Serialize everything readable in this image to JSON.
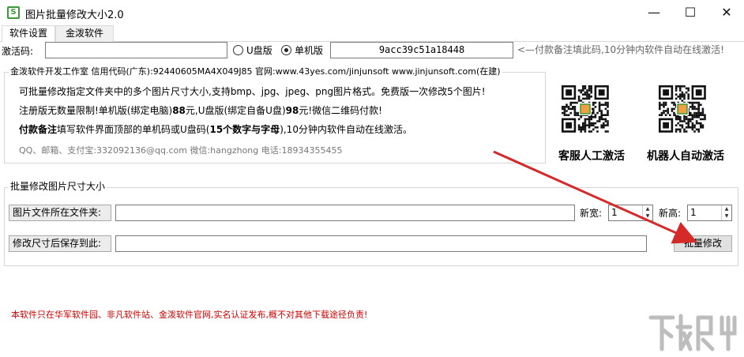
{
  "window": {
    "title": "图片批量修改大小2.0",
    "icon_letter": "S",
    "minimize": "—",
    "maximize": "☐",
    "close": "✕"
  },
  "tabs": [
    {
      "label": "软件设置",
      "active": true
    },
    {
      "label": "金泼软件",
      "active": false
    }
  ],
  "activation": {
    "label": "激活码:",
    "value": "",
    "radio_u": "U盘版",
    "radio_single": "单机版",
    "selected": "单机版",
    "machine_code": "9acc39c51a18448",
    "hint": "<—付款备注填此码,10分钟内软件自动在线激活!"
  },
  "info": {
    "legend": "金泼软件开发工作室 信用代码(广东):92440605MA4X049J85 官网:www.43yes.com/jinjunsoft  www.jinjunsoft.com(在建)",
    "line1": "可批量修改指定文件夹中的多个图片尺寸大小,支持bmp、jpg、jpeg、png图片格式。免费版一次修改5个图片!",
    "line2_a": "注册版无数量限制!单机版(绑定电脑)",
    "line2_b": "88",
    "line2_c": "元,U盘版(绑定自备U盘)",
    "line2_d": "98",
    "line2_e": "元!微信二维码付款!",
    "line3_a": "付款备注",
    "line3_b": "填写软件界面顶部的单机码或U盘码(",
    "line3_c": "15个数字与字母",
    "line3_d": "),10分钟内软件自动在线激活。",
    "contact": "QQ、邮箱、支付宝:332092136@qq.com   微信:hangzhong   电话:18934355455"
  },
  "qr": {
    "service_label": "客服人工激活",
    "robot_label": "机器人自动激活",
    "center_letter": "S"
  },
  "batch": {
    "legend": "批量修改图片尺寸大小",
    "source_label": "图片文件所在文件夹:",
    "source_value": "",
    "dest_label": "修改尺寸后保存到此:",
    "dest_value": "",
    "width_label": "新宽:",
    "width_value": "1",
    "height_label": "新高:",
    "height_value": "1",
    "button": "批量修改"
  },
  "disclaimer": "本软件只在华军软件园、非凡软件站、金泼软件官网,实名认证发布,概不对其他下载途径负责!",
  "watermark": "下载吧",
  "colors": {
    "arrow": "#d42a2a",
    "disclaimer": "#cc0000",
    "icon_green": "#3a9a3a"
  }
}
